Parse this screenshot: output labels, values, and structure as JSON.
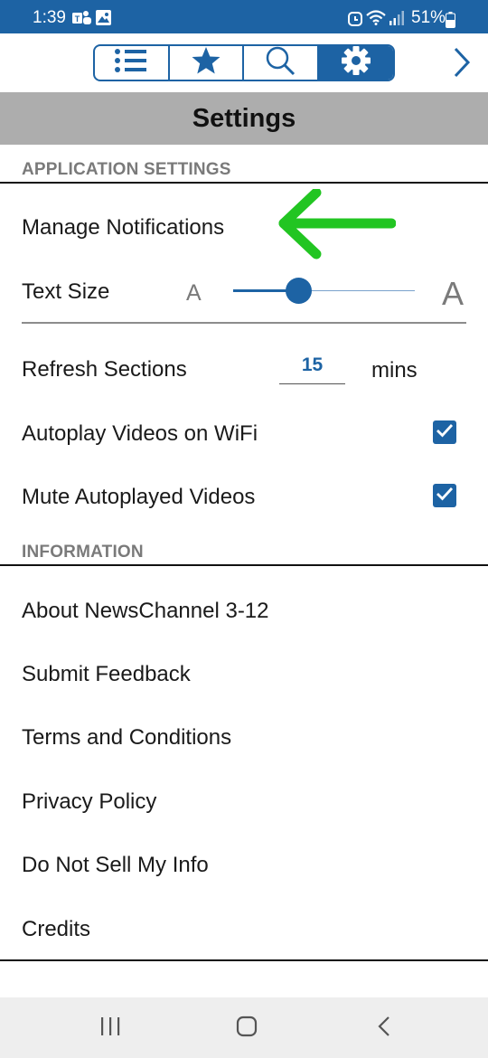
{
  "status_bar": {
    "time": "1:39",
    "battery": "51%",
    "icons": [
      "teams-icon",
      "gallery-icon",
      "alarm-icon",
      "wifi-icon",
      "signal-icon",
      "battery-icon"
    ]
  },
  "toolbar": {
    "tabs": [
      {
        "icon": "list-icon",
        "active": false
      },
      {
        "icon": "star-icon",
        "active": false
      },
      {
        "icon": "search-icon",
        "active": false
      },
      {
        "icon": "gear-icon",
        "active": true
      }
    ],
    "next_icon": "chevron-right-icon"
  },
  "page": {
    "title": "Settings"
  },
  "application_settings": {
    "header": "APPLICATION SETTINGS",
    "manage_notifications": "Manage Notifications",
    "text_size": {
      "label": "Text Size",
      "small_glyph": "A",
      "large_glyph": "A",
      "level": 0.36
    },
    "refresh": {
      "label": "Refresh Sections",
      "value": "15",
      "unit": "mins"
    },
    "autoplay": {
      "label": "Autoplay Videos on WiFi",
      "checked": true
    },
    "mute": {
      "label": "Mute Autoplayed Videos",
      "checked": true
    }
  },
  "information": {
    "header": "INFORMATION",
    "items": [
      "About NewsChannel 3-12",
      "Submit Feedback",
      "Terms and Conditions",
      "Privacy Policy",
      "Do Not Sell My Info",
      "Credits"
    ]
  },
  "annotation": {
    "icon": "green-arrow-icon",
    "color": "#22c522"
  },
  "colors": {
    "accent": "#1d63a4",
    "title_bar": "#adadad",
    "section_header": "#7a7a7a"
  },
  "nav_bar": {
    "icons": [
      "recents-icon",
      "home-icon",
      "back-icon"
    ]
  }
}
